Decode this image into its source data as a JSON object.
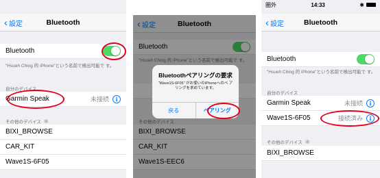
{
  "screen1": {
    "nav": {
      "back": "設定",
      "title": "Bluetooth"
    },
    "bluetooth_label": "Bluetooth",
    "description": "\"Hsueh Ching 的 iPhone\"という名前で検出可能で す。",
    "my_devices_header": "自分のデバイス",
    "my_device": {
      "name": "Garmin Speak",
      "status": "未接続"
    },
    "other_devices_header": "その他のデバイス",
    "other_devices": [
      "BIXI_BROWSE",
      "CAR_KIT",
      "Wave1S-6F05"
    ]
  },
  "screen2": {
    "nav": {
      "back": "設定",
      "title": "Bluetooth"
    },
    "bluetooth_label": "Bluetooth",
    "description": "\"Hsueh Ching 的 iPhone\"という名前で検出可能で す。",
    "other_devices_header": "その他のデバイス",
    "other_devices": [
      "BIXI_BROWSE",
      "CAR_KIT",
      "Wave1S-EEC6"
    ],
    "alert": {
      "title": "Bluetoothペアリングの要求",
      "message": "\"Wave1S-6F05\" がお使いのiPhoneへのペ アリングを求めています。",
      "cancel": "戻る",
      "pair": "ペアリング"
    }
  },
  "screen3": {
    "status": {
      "carrier": "圏外",
      "time": "14:33"
    },
    "nav": {
      "back": "設定",
      "title": "Bluetooth"
    },
    "bluetooth_label": "Bluetooth",
    "description": "\"Hsueh Ching 的 iPhone\"という名前で検出可能で す。",
    "my_devices_header": "自分のデバイス",
    "my_devices": [
      {
        "name": "Garmin Speak",
        "status": "未接続"
      },
      {
        "name": "Wave1S-6F05",
        "status": "接続済み"
      }
    ],
    "other_devices_header": "その他のデバイス",
    "other_devices": [
      "BIXI_BROWSE"
    ]
  },
  "colors": {
    "accent": "#007aff",
    "toggle_on": "#4cd964",
    "highlight_ring": "#e0001b"
  }
}
